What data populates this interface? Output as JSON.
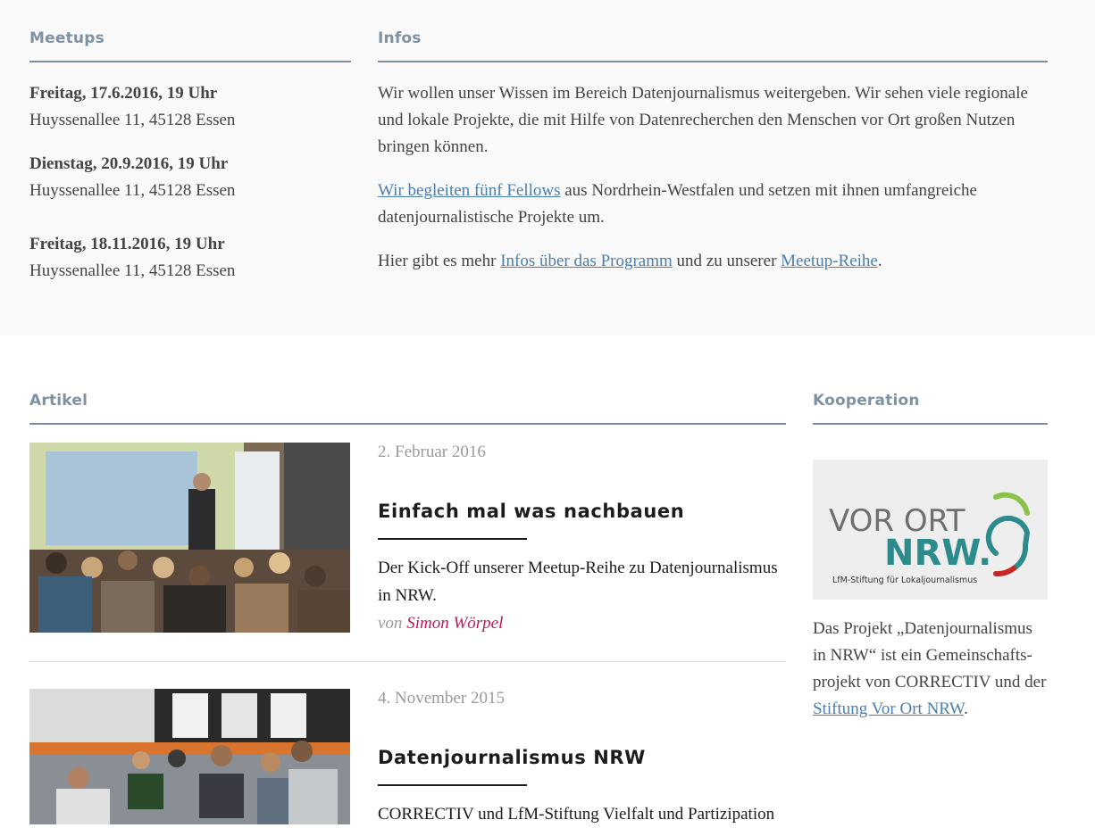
{
  "meetups": {
    "heading": "Meetups",
    "items": [
      {
        "date": "Freitag, 17.6.2016, 19 Uhr",
        "address": "Huyssenallee 11, 45128 Essen"
      },
      {
        "date": "Dienstag, 20.9.2016, 19 Uhr",
        "address": "Huyssenallee 11, 45128 Essen"
      },
      {
        "date": "Freitag, 18.11.2016, 19 Uhr",
        "address": "Huyssenallee 11, 45128 Essen"
      }
    ]
  },
  "infos": {
    "heading": "Infos",
    "p1": "Wir wollen unser Wissen im Bereich Datenjournalismus weitergeben. Wir sehen viele regionale und lokale Projekte, die mit Hilfe von Datenrecherchen den Menschen vor Ort großen Nutzen bringen können.",
    "p2_link": "Wir begleiten fünf Fellows",
    "p2_rest": " aus Nordrhein-Westfalen und setzen mit ihnen umfangreiche datenjournalistische Projekte um.",
    "p3_pre": "Hier gibt es mehr ",
    "p3_link1": "Infos über das Programm",
    "p3_mid": " und zu unserer ",
    "p3_link2": "Meetup-Reihe",
    "p3_end": "."
  },
  "artikel": {
    "heading": "Artikel",
    "items": [
      {
        "date": "2. Februar 2016",
        "title": "Einfach mal was nachbauen",
        "teaser": "Der Kick-Off unserer Meetup-Reihe zu Datenjournalismus in NRW.",
        "author_prefix": "von",
        "author": "Simon Wörpel"
      },
      {
        "date": "4. November 2015",
        "title": "Datenjournalismus NRW",
        "teaser": "CORRECTIV und LfM-Stiftung Vielfalt und Partizipation"
      }
    ]
  },
  "kooperation": {
    "heading": "Kooperation",
    "logo_line1": "VOR ORT",
    "logo_line2": "NRW.",
    "logo_sub": "LfM-Stiftung für Lokaljournalismus",
    "text_pre": "Das Projekt „Datenjournalismus in NRW“ ist ein Gemeinschafts-projekt von CORRECTIV und der ",
    "text_link": "Stiftung Vor Ort NRW",
    "text_end": "."
  },
  "colors": {
    "heading": "#7f92a3",
    "link": "#4c7eac",
    "author": "#c2185b",
    "logo_teal": "#2e8b8b"
  }
}
